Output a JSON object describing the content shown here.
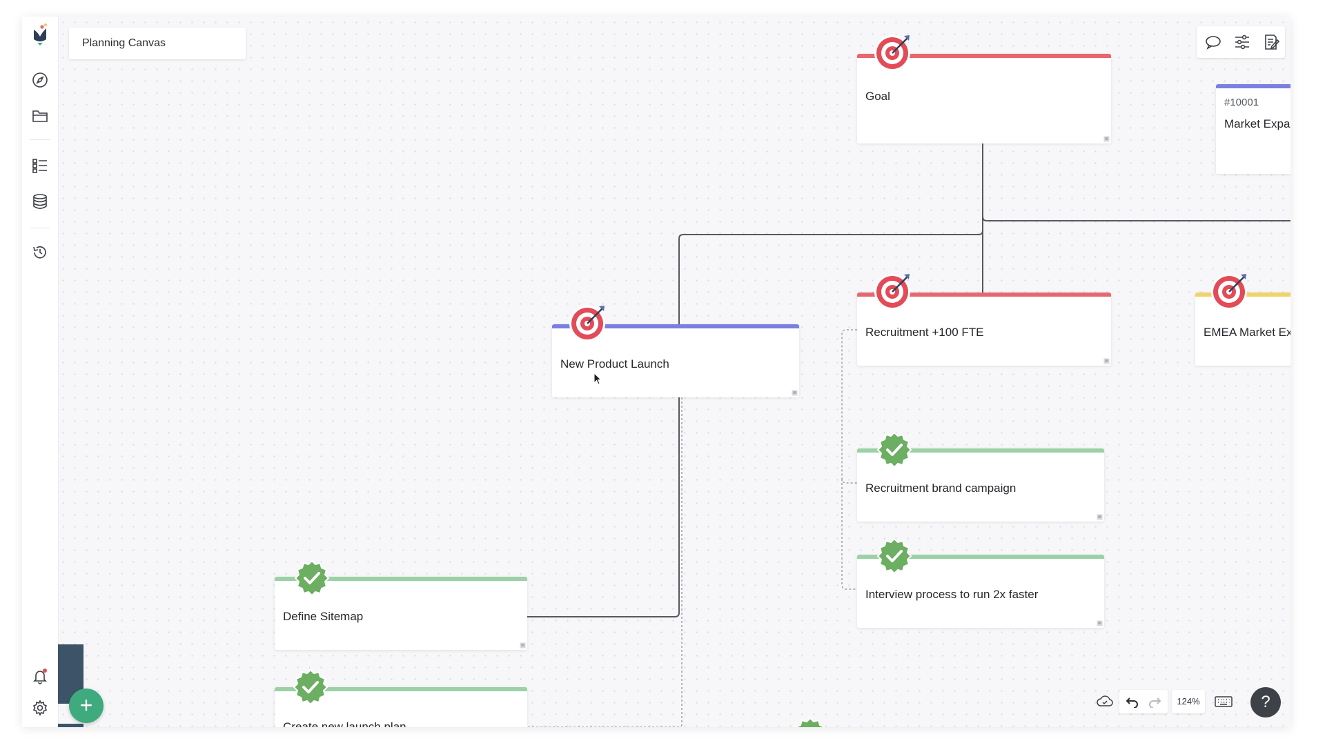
{
  "app": {
    "canvas_title": "Planning Canvas",
    "zoom_level": "124%",
    "help_label": "?",
    "add_label": "+"
  },
  "sidebar": {
    "items": [
      {
        "icon": "logo-icon"
      },
      {
        "icon": "compass-icon"
      },
      {
        "icon": "folder-icon"
      },
      {
        "icon": "list-icon"
      },
      {
        "icon": "database-icon"
      },
      {
        "icon": "history-icon"
      },
      {
        "icon": "bell-icon"
      },
      {
        "icon": "gear-icon"
      }
    ]
  },
  "toolbar": {
    "top": [
      "comment-icon",
      "filter-sliders-icon",
      "edit-notes-icon"
    ],
    "bottom": [
      "cloud-sync-icon",
      "undo-icon",
      "redo-icon",
      "keyboard-icon"
    ]
  },
  "colors": {
    "goal_bar": "#e8676f",
    "goal_alt_bar": "#7b7fe0",
    "emea_bar": "#f0d36b",
    "task_bar": "#9cd0a6",
    "accent_green": "#3faa7e",
    "target_red": "#e24b57"
  },
  "cards": {
    "goal": {
      "title": "Goal"
    },
    "new_product_launch": {
      "title": "New Product Launch"
    },
    "recruitment": {
      "title": "Recruitment +100 FTE"
    },
    "emea": {
      "title": "EMEA Market Ex"
    },
    "market_expansion": {
      "id": "#10001",
      "title": "Market Expa"
    },
    "recruitment_brand": {
      "title": "Recruitment brand campaign"
    },
    "interview_process": {
      "title": "Interview process to run 2x faster"
    },
    "define_sitemap": {
      "title": "Define Sitemap"
    },
    "launch_plan": {
      "title": "Create new launch plan"
    }
  }
}
